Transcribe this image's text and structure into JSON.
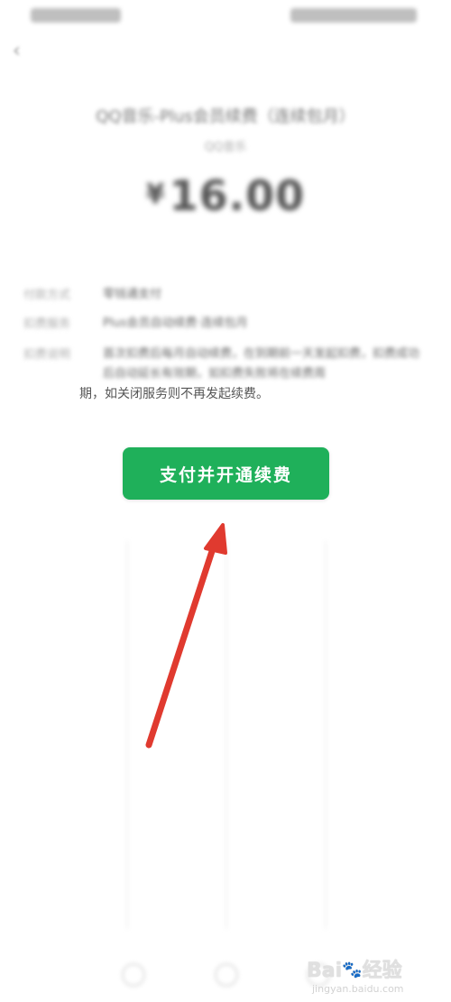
{
  "payment": {
    "merchant_title": "QQ音乐-Plus会员续费（连续包月）",
    "merchant_sub": "QQ音乐",
    "currency_symbol": "¥",
    "amount": "16.00"
  },
  "info": {
    "rows": [
      {
        "label": "付款方式",
        "value": "零钱通支付"
      },
      {
        "label": "扣费服务",
        "value": "Plus会员自动续费·连续包月"
      },
      {
        "label": "扣费说明",
        "value": "首次扣费后每月自动续费，在到期前一天发起扣费，扣费成功后自动延长有效期，如扣费失败将在续费周"
      }
    ],
    "clear_line": "期，如关闭服务则不再发起续费。"
  },
  "pay_button": {
    "label": "支付并开通续费"
  },
  "watermark": {
    "logo_left": "Bai",
    "logo_right": "经验",
    "url": "jingyan.baidu.com"
  },
  "colors": {
    "button_green": "#1fb05a",
    "arrow_red": "#e03a2f"
  }
}
